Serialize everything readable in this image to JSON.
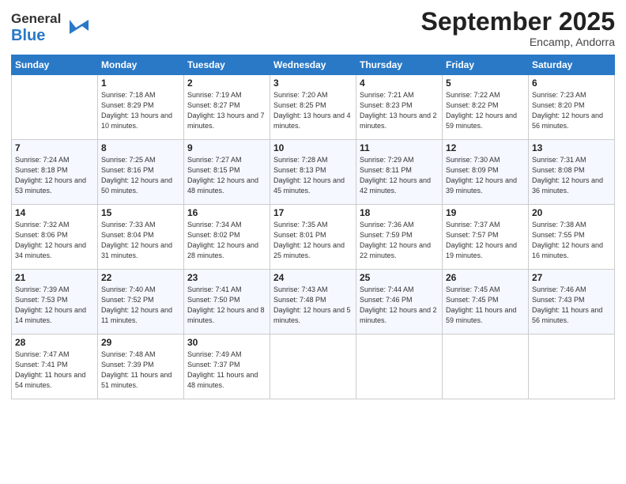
{
  "header": {
    "logo_general": "General",
    "logo_blue": "Blue",
    "month_title": "September 2025",
    "subtitle": "Encamp, Andorra"
  },
  "days_of_week": [
    "Sunday",
    "Monday",
    "Tuesday",
    "Wednesday",
    "Thursday",
    "Friday",
    "Saturday"
  ],
  "weeks": [
    [
      {
        "day": "",
        "sunrise": "",
        "sunset": "",
        "daylight": ""
      },
      {
        "day": "1",
        "sunrise": "Sunrise: 7:18 AM",
        "sunset": "Sunset: 8:29 PM",
        "daylight": "Daylight: 13 hours and 10 minutes."
      },
      {
        "day": "2",
        "sunrise": "Sunrise: 7:19 AM",
        "sunset": "Sunset: 8:27 PM",
        "daylight": "Daylight: 13 hours and 7 minutes."
      },
      {
        "day": "3",
        "sunrise": "Sunrise: 7:20 AM",
        "sunset": "Sunset: 8:25 PM",
        "daylight": "Daylight: 13 hours and 4 minutes."
      },
      {
        "day": "4",
        "sunrise": "Sunrise: 7:21 AM",
        "sunset": "Sunset: 8:23 PM",
        "daylight": "Daylight: 13 hours and 2 minutes."
      },
      {
        "day": "5",
        "sunrise": "Sunrise: 7:22 AM",
        "sunset": "Sunset: 8:22 PM",
        "daylight": "Daylight: 12 hours and 59 minutes."
      },
      {
        "day": "6",
        "sunrise": "Sunrise: 7:23 AM",
        "sunset": "Sunset: 8:20 PM",
        "daylight": "Daylight: 12 hours and 56 minutes."
      }
    ],
    [
      {
        "day": "7",
        "sunrise": "Sunrise: 7:24 AM",
        "sunset": "Sunset: 8:18 PM",
        "daylight": "Daylight: 12 hours and 53 minutes."
      },
      {
        "day": "8",
        "sunrise": "Sunrise: 7:25 AM",
        "sunset": "Sunset: 8:16 PM",
        "daylight": "Daylight: 12 hours and 50 minutes."
      },
      {
        "day": "9",
        "sunrise": "Sunrise: 7:27 AM",
        "sunset": "Sunset: 8:15 PM",
        "daylight": "Daylight: 12 hours and 48 minutes."
      },
      {
        "day": "10",
        "sunrise": "Sunrise: 7:28 AM",
        "sunset": "Sunset: 8:13 PM",
        "daylight": "Daylight: 12 hours and 45 minutes."
      },
      {
        "day": "11",
        "sunrise": "Sunrise: 7:29 AM",
        "sunset": "Sunset: 8:11 PM",
        "daylight": "Daylight: 12 hours and 42 minutes."
      },
      {
        "day": "12",
        "sunrise": "Sunrise: 7:30 AM",
        "sunset": "Sunset: 8:09 PM",
        "daylight": "Daylight: 12 hours and 39 minutes."
      },
      {
        "day": "13",
        "sunrise": "Sunrise: 7:31 AM",
        "sunset": "Sunset: 8:08 PM",
        "daylight": "Daylight: 12 hours and 36 minutes."
      }
    ],
    [
      {
        "day": "14",
        "sunrise": "Sunrise: 7:32 AM",
        "sunset": "Sunset: 8:06 PM",
        "daylight": "Daylight: 12 hours and 34 minutes."
      },
      {
        "day": "15",
        "sunrise": "Sunrise: 7:33 AM",
        "sunset": "Sunset: 8:04 PM",
        "daylight": "Daylight: 12 hours and 31 minutes."
      },
      {
        "day": "16",
        "sunrise": "Sunrise: 7:34 AM",
        "sunset": "Sunset: 8:02 PM",
        "daylight": "Daylight: 12 hours and 28 minutes."
      },
      {
        "day": "17",
        "sunrise": "Sunrise: 7:35 AM",
        "sunset": "Sunset: 8:01 PM",
        "daylight": "Daylight: 12 hours and 25 minutes."
      },
      {
        "day": "18",
        "sunrise": "Sunrise: 7:36 AM",
        "sunset": "Sunset: 7:59 PM",
        "daylight": "Daylight: 12 hours and 22 minutes."
      },
      {
        "day": "19",
        "sunrise": "Sunrise: 7:37 AM",
        "sunset": "Sunset: 7:57 PM",
        "daylight": "Daylight: 12 hours and 19 minutes."
      },
      {
        "day": "20",
        "sunrise": "Sunrise: 7:38 AM",
        "sunset": "Sunset: 7:55 PM",
        "daylight": "Daylight: 12 hours and 16 minutes."
      }
    ],
    [
      {
        "day": "21",
        "sunrise": "Sunrise: 7:39 AM",
        "sunset": "Sunset: 7:53 PM",
        "daylight": "Daylight: 12 hours and 14 minutes."
      },
      {
        "day": "22",
        "sunrise": "Sunrise: 7:40 AM",
        "sunset": "Sunset: 7:52 PM",
        "daylight": "Daylight: 12 hours and 11 minutes."
      },
      {
        "day": "23",
        "sunrise": "Sunrise: 7:41 AM",
        "sunset": "Sunset: 7:50 PM",
        "daylight": "Daylight: 12 hours and 8 minutes."
      },
      {
        "day": "24",
        "sunrise": "Sunrise: 7:43 AM",
        "sunset": "Sunset: 7:48 PM",
        "daylight": "Daylight: 12 hours and 5 minutes."
      },
      {
        "day": "25",
        "sunrise": "Sunrise: 7:44 AM",
        "sunset": "Sunset: 7:46 PM",
        "daylight": "Daylight: 12 hours and 2 minutes."
      },
      {
        "day": "26",
        "sunrise": "Sunrise: 7:45 AM",
        "sunset": "Sunset: 7:45 PM",
        "daylight": "Daylight: 11 hours and 59 minutes."
      },
      {
        "day": "27",
        "sunrise": "Sunrise: 7:46 AM",
        "sunset": "Sunset: 7:43 PM",
        "daylight": "Daylight: 11 hours and 56 minutes."
      }
    ],
    [
      {
        "day": "28",
        "sunrise": "Sunrise: 7:47 AM",
        "sunset": "Sunset: 7:41 PM",
        "daylight": "Daylight: 11 hours and 54 minutes."
      },
      {
        "day": "29",
        "sunrise": "Sunrise: 7:48 AM",
        "sunset": "Sunset: 7:39 PM",
        "daylight": "Daylight: 11 hours and 51 minutes."
      },
      {
        "day": "30",
        "sunrise": "Sunrise: 7:49 AM",
        "sunset": "Sunset: 7:37 PM",
        "daylight": "Daylight: 11 hours and 48 minutes."
      },
      {
        "day": "",
        "sunrise": "",
        "sunset": "",
        "daylight": ""
      },
      {
        "day": "",
        "sunrise": "",
        "sunset": "",
        "daylight": ""
      },
      {
        "day": "",
        "sunrise": "",
        "sunset": "",
        "daylight": ""
      },
      {
        "day": "",
        "sunrise": "",
        "sunset": "",
        "daylight": ""
      }
    ]
  ]
}
